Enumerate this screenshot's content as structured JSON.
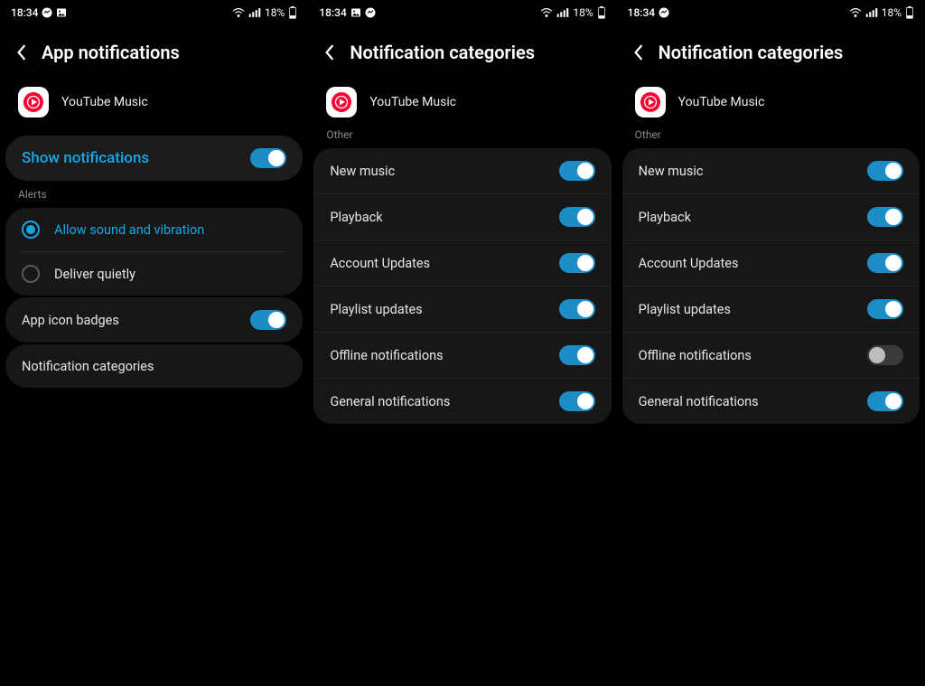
{
  "status": {
    "time": "18:34",
    "battery_text": "18%"
  },
  "screens": [
    {
      "title": "App notifications",
      "app_name": "YouTube Music",
      "show_notifications_label": "Show notifications",
      "show_notifications_on": true,
      "alerts_header": "Alerts",
      "alerts": [
        {
          "label": "Allow sound and vibration",
          "selected": true
        },
        {
          "label": "Deliver quietly",
          "selected": false
        }
      ],
      "app_icon_badges_label": "App icon badges",
      "app_icon_badges_on": true,
      "notification_categories_label": "Notification categories"
    },
    {
      "title": "Notification categories",
      "app_name": "YouTube Music",
      "other_header": "Other",
      "items": [
        {
          "label": "New music",
          "on": true
        },
        {
          "label": "Playback",
          "on": true
        },
        {
          "label": "Account Updates",
          "on": true
        },
        {
          "label": "Playlist updates",
          "on": true
        },
        {
          "label": "Offline notifications",
          "on": true
        },
        {
          "label": "General notifications",
          "on": true
        }
      ]
    },
    {
      "title": "Notification categories",
      "app_name": "YouTube Music",
      "other_header": "Other",
      "items": [
        {
          "label": "New music",
          "on": true
        },
        {
          "label": "Playback",
          "on": true
        },
        {
          "label": "Account Updates",
          "on": true
        },
        {
          "label": "Playlist updates",
          "on": true
        },
        {
          "label": "Offline notifications",
          "on": false
        },
        {
          "label": "General notifications",
          "on": true
        }
      ]
    }
  ]
}
